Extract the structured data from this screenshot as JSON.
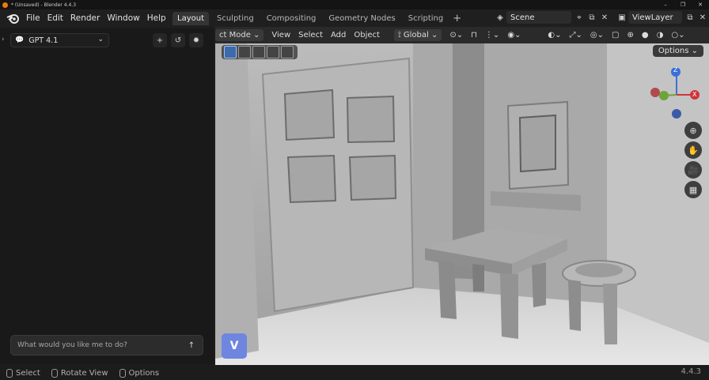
{
  "window": {
    "title": "* (Unsaved) - Blender 4.4.3",
    "controls": [
      "–",
      "❐",
      "✕"
    ]
  },
  "menu": [
    "File",
    "Edit",
    "Render",
    "Window",
    "Help"
  ],
  "workspace_tabs": [
    "Layout",
    "Sculpting",
    "Compositing",
    "Geometry Nodes",
    "Scripting"
  ],
  "active_tab": "Layout",
  "scene": {
    "name": "Scene",
    "view_layer": "ViewLayer"
  },
  "left_panel": {
    "model": "GPT 4.1",
    "prompt_placeholder": "What would you like me to do?"
  },
  "viewport_header": {
    "mode": "ct Mode",
    "menus": [
      "View",
      "Select",
      "Add",
      "Object"
    ],
    "orientation": "Global",
    "options": "Options"
  },
  "gizmo": {
    "x": "X",
    "y": "Y",
    "z": "Z"
  },
  "status": {
    "items": [
      "Select",
      "Rotate View",
      "Options"
    ],
    "version": "4.4.3"
  },
  "colors": {
    "accent": "#6e86e0",
    "active_tab": "#353535"
  }
}
